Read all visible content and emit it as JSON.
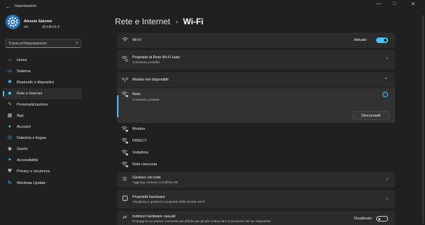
{
  "window": {
    "title": "Impostazioni",
    "controls": [
      "—",
      "□",
      "✕"
    ]
  },
  "user": {
    "name": "Alessio Salome",
    "email": "ale              @outlook.it"
  },
  "search": {
    "placeholder": "Trova un'impostazione"
  },
  "sidebar": {
    "items": [
      {
        "label": "Home",
        "icon": "home-icon",
        "color": "#e8a94a",
        "glyph": "⌂"
      },
      {
        "label": "Sistema",
        "icon": "monitor-icon",
        "color": "#4cc2ff",
        "glyph": "▭"
      },
      {
        "label": "Bluetooth e dispositivi",
        "icon": "bluetooth-icon",
        "color": "#4cc2ff",
        "glyph": "✱"
      },
      {
        "label": "Rete e Internet",
        "icon": "network-icon",
        "color": "#4cc2ff",
        "glyph": "◆",
        "active": true
      },
      {
        "label": "Personalizzazione",
        "icon": "brush-icon",
        "color": "#e8a94a",
        "glyph": "✎"
      },
      {
        "label": "App",
        "icon": "apps-icon",
        "color": "#c7c7c7",
        "glyph": "▦"
      },
      {
        "label": "Account",
        "icon": "account-icon",
        "color": "#48c78e",
        "glyph": "●"
      },
      {
        "label": "Data/ora e lingua",
        "icon": "clock-globe-icon",
        "color": "#4cc2ff",
        "glyph": "◷"
      },
      {
        "label": "Giochi",
        "icon": "gamepad-icon",
        "color": "#c7c7c7",
        "glyph": "◉"
      },
      {
        "label": "Accessibilità",
        "icon": "accessibility-icon",
        "color": "#4cc2ff",
        "glyph": "✦"
      },
      {
        "label": "Privacy e sicurezza",
        "icon": "shield-icon",
        "color": "#a8a8a8",
        "glyph": "⛊"
      },
      {
        "label": "Windows Update",
        "icon": "update-icon",
        "color": "#4cc2ff",
        "glyph": "↻"
      }
    ]
  },
  "breadcrumb": {
    "parent": "Rete e Internet",
    "separator": "›",
    "current": "Wi-Fi"
  },
  "wifi": {
    "label": "Wi-Fi",
    "state_label": "Attivato",
    "on": true
  },
  "network_properties": {
    "title": "Proprietà di Rete Wi-Fi Halo",
    "subtitle": "Connessa, protetta"
  },
  "available": {
    "title": "Mostra reti disponibili"
  },
  "connected": {
    "name": "Rete",
    "status": "Connessa, protetta",
    "button": "Disconnetti"
  },
  "networks": [
    "Modem",
    "DIRECT-",
    "Vodafone",
    "Rete nascosta"
  ],
  "manage": {
    "title": "Gestisci reti note",
    "subtitle": "Aggiungi, rimuovi o modifica reti"
  },
  "hardware": {
    "title": "Proprietà hardware",
    "subtitle": "Visualizza e gestisci le proprietà della scheda Wi-Fi"
  },
  "random_mac": {
    "title": "Indirizzi hardware casuali",
    "subtitle": "Proteggi la tua privacy rendendo più difficile per gli altri rintracciare la posizione del tuo dispositivo",
    "state_label": "Disattivato",
    "on": false
  },
  "colors": {
    "accent": "#4cc2ff",
    "background": "#202020",
    "card": "#2b2b2b"
  }
}
